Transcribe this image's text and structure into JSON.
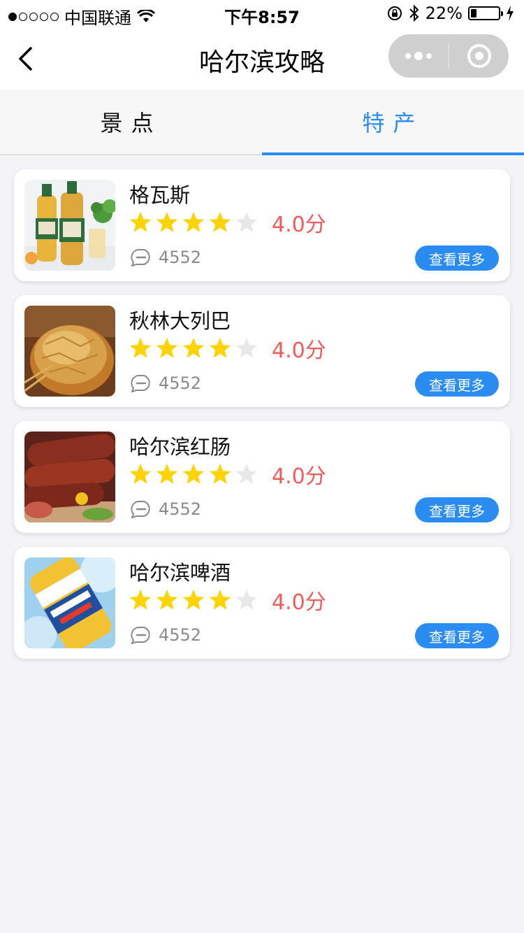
{
  "status_bar": {
    "carrier": "中国联通",
    "time": "下午8:57",
    "battery_text": "22%",
    "battery_level": 0.22
  },
  "nav": {
    "title": "哈尔滨攻略"
  },
  "tabs": [
    {
      "label": "景点",
      "active": false
    },
    {
      "label": "特产",
      "active": true
    }
  ],
  "items": [
    {
      "name": "格瓦斯",
      "rating": 4,
      "score_text": "4.0分",
      "comments": "4552",
      "more_label": "查看更多",
      "image": "kvass-bottles"
    },
    {
      "name": "秋林大列巴",
      "rating": 4,
      "score_text": "4.0分",
      "comments": "4552",
      "more_label": "查看更多",
      "image": "bread-loaf"
    },
    {
      "name": "哈尔滨红肠",
      "rating": 4,
      "score_text": "4.0分",
      "comments": "4552",
      "more_label": "查看更多",
      "image": "red-sausage"
    },
    {
      "name": "哈尔滨啤酒",
      "rating": 4,
      "score_text": "4.0分",
      "comments": "4552",
      "more_label": "查看更多",
      "image": "harbin-beer"
    }
  ],
  "colors": {
    "accent": "#2a8cf0",
    "score": "#ef5a5a",
    "star_on": "#ffd300",
    "star_off": "#e8e8e8"
  }
}
